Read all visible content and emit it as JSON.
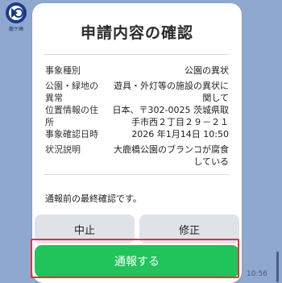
{
  "logo": {
    "caption": "龍ケ崎",
    "icon": "city-logo-icon"
  },
  "card": {
    "title": "申請内容の確認",
    "rows": [
      {
        "label": "事象種別",
        "value": "公園の異状"
      },
      {
        "label": "公園・緑地の異常",
        "value": "遊具・外灯等の施設の異状に関して"
      },
      {
        "label": "位置情報の住所",
        "value": "日本、〒302-0025 茨城県取手市西２丁目２９－２１"
      },
      {
        "label": "事象確認日時",
        "value": "2026 年1月14日 10:50"
      },
      {
        "label": "状況説明",
        "value": "大鹿橋公園のブランコが腐食している"
      }
    ],
    "notice": "通報前の最終確認です。",
    "cancel_label": "中止",
    "edit_label": "修正",
    "submit_label": "通報する"
  },
  "message_time": "10:56",
  "colors": {
    "background": "#8fa8cf",
    "primary": "#21c45a",
    "highlight": "#e0353b",
    "secondary_button": "#dfe3e8"
  }
}
